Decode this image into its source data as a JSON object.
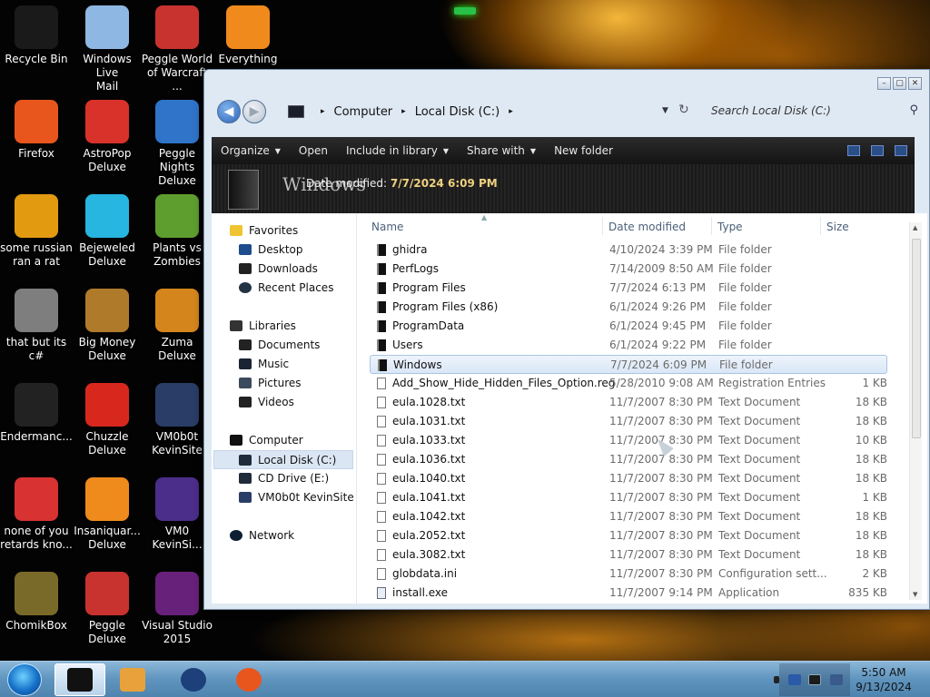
{
  "desktop": {
    "icons": [
      {
        "label": "Recycle Bin",
        "icon": "recycle-bin-icon",
        "color": "#1a1a1a"
      },
      {
        "label": "Windows Live\nMail",
        "icon": "mail-icon",
        "color": "#8fb7e3"
      },
      {
        "label": "Peggle World\nof Warcraft ...",
        "icon": "peggle-icon",
        "color": "#c8332f"
      },
      {
        "label": "Everything",
        "icon": "magnifier-icon",
        "color": "#f08a1c"
      },
      {
        "label": "Firefox",
        "icon": "firefox-icon",
        "color": "#e8561d"
      },
      {
        "label": "AstroPop\nDeluxe",
        "icon": "astropop-icon",
        "color": "#d8322a"
      },
      {
        "label": "Peggle Nights\nDeluxe",
        "icon": "peggle-nights-icon",
        "color": "#2f74c9"
      },
      {
        "label": "some russian\nran a rat",
        "icon": "de-app-icon",
        "color": "#e29a10"
      },
      {
        "label": "Bejeweled\nDeluxe",
        "icon": "gem-icon",
        "color": "#27b6e0"
      },
      {
        "label": "Plants vs\nZombies",
        "icon": "plant-icon",
        "color": "#5e9e2f"
      },
      {
        "label": "that but its c#",
        "icon": "stack-icon",
        "color": "#7e7e7e"
      },
      {
        "label": "Big Money\nDeluxe",
        "icon": "money-bag-icon",
        "color": "#b07a2b"
      },
      {
        "label": "Zuma Deluxe",
        "icon": "zuma-icon",
        "color": "#d4861c"
      },
      {
        "label": "Endermanc...",
        "icon": "terminal-icon",
        "color": "#222222"
      },
      {
        "label": "Chuzzle\nDeluxe",
        "icon": "chuzzle-icon",
        "color": "#d8281e"
      },
      {
        "label": "VM0b0t\nKevinSite",
        "icon": "monitor-icon",
        "color": "#2a3d66"
      },
      {
        "label": "none of you\nretards kno...",
        "icon": "red-app-icon",
        "color": "#d83232"
      },
      {
        "label": "Insaniquar...\nDeluxe",
        "icon": "fish-icon",
        "color": "#ef8a1c"
      },
      {
        "label": "VM0\nKevinSi...",
        "icon": "firefox-file-icon",
        "color": "#4b2e8a"
      },
      {
        "label": "ChomikBox",
        "icon": "chomikbox-icon",
        "color": "#7a6a2a"
      },
      {
        "label": "Peggle Deluxe",
        "icon": "peggle-deluxe-icon",
        "color": "#c8332f"
      },
      {
        "label": "Visual Studio\n2015",
        "icon": "visual-studio-icon",
        "color": "#68217a"
      }
    ]
  },
  "explorer": {
    "address": {
      "crumbs": [
        "Computer",
        "Local Disk (C:)"
      ]
    },
    "search_placeholder": "Search Local Disk (C:)",
    "toolbar": {
      "organize": "Organize",
      "open": "Open",
      "include_in_library": "Include in library",
      "share_with": "Share with",
      "new_folder": "New folder"
    },
    "preview": {
      "name": "Windows",
      "meta_label": "Date modified:",
      "meta_value": "7/7/2024 6:09 PM"
    },
    "nav": {
      "favorites": "Favorites",
      "desktop": "Desktop",
      "downloads": "Downloads",
      "recent_places": "Recent Places",
      "libraries": "Libraries",
      "documents": "Documents",
      "music": "Music",
      "pictures": "Pictures",
      "videos": "Videos",
      "computer": "Computer",
      "local_disk": "Local Disk (C:)",
      "cd_drive": "CD Drive (E:)",
      "vm_site": "VM0b0t KevinSite",
      "network": "Network"
    },
    "columns": {
      "name": "Name",
      "date": "Date modified",
      "type": "Type",
      "size": "Size"
    },
    "files": [
      {
        "name": "ghidra",
        "date": "4/10/2024 3:39 PM",
        "type": "File folder",
        "size": "",
        "kind": "folder"
      },
      {
        "name": "PerfLogs",
        "date": "7/14/2009 8:50 AM",
        "type": "File folder",
        "size": "",
        "kind": "folder"
      },
      {
        "name": "Program Files",
        "date": "7/7/2024 6:13 PM",
        "type": "File folder",
        "size": "",
        "kind": "folder"
      },
      {
        "name": "Program Files (x86)",
        "date": "6/1/2024 9:26 PM",
        "type": "File folder",
        "size": "",
        "kind": "folder"
      },
      {
        "name": "ProgramData",
        "date": "6/1/2024 9:45 PM",
        "type": "File folder",
        "size": "",
        "kind": "folder"
      },
      {
        "name": "Users",
        "date": "6/1/2024 9:22 PM",
        "type": "File folder",
        "size": "",
        "kind": "folder"
      },
      {
        "name": "Windows",
        "date": "7/7/2024 6:09 PM",
        "type": "File folder",
        "size": "",
        "kind": "folder",
        "selected": true
      },
      {
        "name": "Add_Show_Hide_Hidden_Files_Option.reg",
        "date": "5/28/2010 9:08 AM",
        "type": "Registration Entries",
        "size": "1 KB",
        "kind": "doc"
      },
      {
        "name": "eula.1028.txt",
        "date": "11/7/2007 8:30 PM",
        "type": "Text Document",
        "size": "18 KB",
        "kind": "doc"
      },
      {
        "name": "eula.1031.txt",
        "date": "11/7/2007 8:30 PM",
        "type": "Text Document",
        "size": "18 KB",
        "kind": "doc"
      },
      {
        "name": "eula.1033.txt",
        "date": "11/7/2007 8:30 PM",
        "type": "Text Document",
        "size": "10 KB",
        "kind": "doc"
      },
      {
        "name": "eula.1036.txt",
        "date": "11/7/2007 8:30 PM",
        "type": "Text Document",
        "size": "18 KB",
        "kind": "doc"
      },
      {
        "name": "eula.1040.txt",
        "date": "11/7/2007 8:30 PM",
        "type": "Text Document",
        "size": "18 KB",
        "kind": "doc"
      },
      {
        "name": "eula.1041.txt",
        "date": "11/7/2007 8:30 PM",
        "type": "Text Document",
        "size": "1 KB",
        "kind": "doc"
      },
      {
        "name": "eula.1042.txt",
        "date": "11/7/2007 8:30 PM",
        "type": "Text Document",
        "size": "18 KB",
        "kind": "doc"
      },
      {
        "name": "eula.2052.txt",
        "date": "11/7/2007 8:30 PM",
        "type": "Text Document",
        "size": "18 KB",
        "kind": "doc"
      },
      {
        "name": "eula.3082.txt",
        "date": "11/7/2007 8:30 PM",
        "type": "Text Document",
        "size": "18 KB",
        "kind": "doc"
      },
      {
        "name": "globdata.ini",
        "date": "11/7/2007 8:30 PM",
        "type": "Configuration sett...",
        "size": "2 KB",
        "kind": "doc"
      },
      {
        "name": "install.exe",
        "date": "11/7/2007 9:14 PM",
        "type": "Application",
        "size": "835 KB",
        "kind": "exe"
      }
    ]
  },
  "taskbar": {
    "clock_time": "5:50 AM",
    "clock_date": "9/13/2024",
    "buttons": [
      {
        "name": "taskbar-explorer-button",
        "color": "#111111",
        "active": true
      },
      {
        "name": "taskbar-media-button",
        "color": "#e9a23b",
        "active": false
      },
      {
        "name": "taskbar-globe-button",
        "color": "#1d3f7a",
        "active": false
      },
      {
        "name": "taskbar-firefox-button",
        "color": "#e8561d",
        "active": false
      }
    ]
  }
}
